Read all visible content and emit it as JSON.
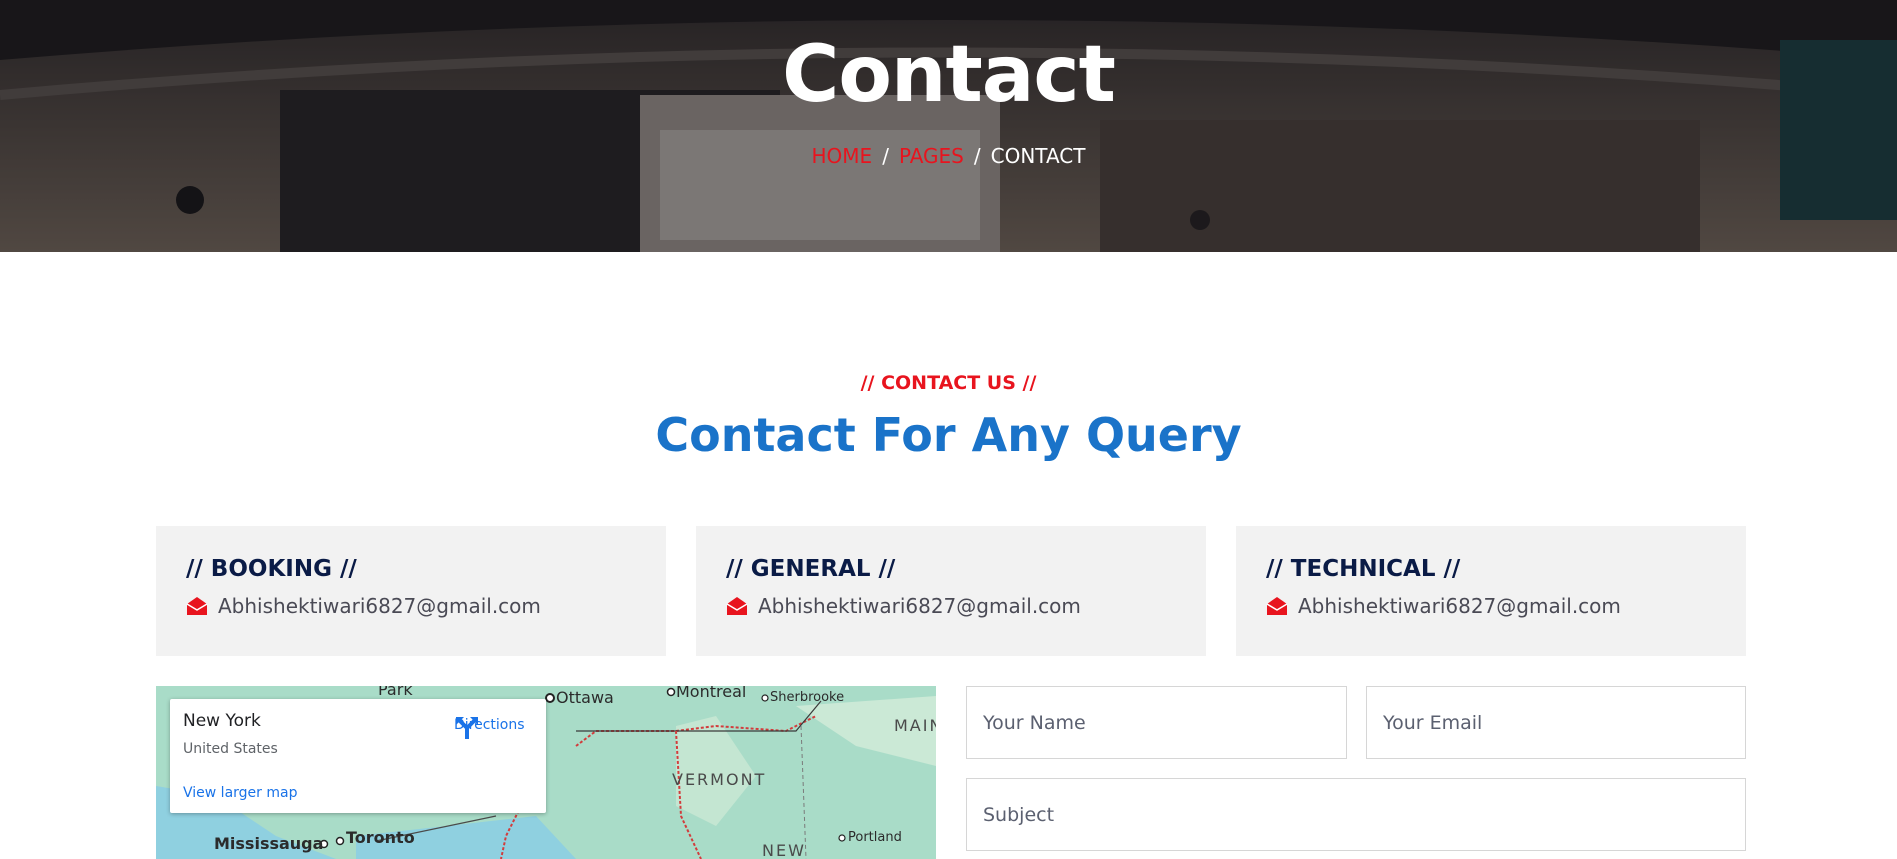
{
  "hero": {
    "title": "Contact",
    "breadcrumb": {
      "home": "HOME",
      "pages": "PAGES",
      "current": "CONTACT",
      "separator": "/"
    }
  },
  "section": {
    "eyebrow": "// CONTACT US //",
    "title": "Contact For Any Query"
  },
  "cards": [
    {
      "heading": "// BOOKING //",
      "email": "Abhishektiwari6827@gmail.com",
      "icon": "envelope-open-icon"
    },
    {
      "heading": "// GENERAL //",
      "email": "Abhishektiwari6827@gmail.com",
      "icon": "envelope-open-icon"
    },
    {
      "heading": "// TECHNICAL //",
      "email": "Abhishektiwari6827@gmail.com",
      "icon": "envelope-open-icon"
    }
  ],
  "map": {
    "place": "New York",
    "country": "United States",
    "directions": "Directions",
    "larger_map": "View larger map",
    "labels": {
      "park": "Park",
      "ottawa": "Ottawa",
      "montreal": "Montreal",
      "sherbrooke": "Sherbrooke",
      "maine": "MAIN",
      "vermont": "VERMONT",
      "mississauga": "Mississauga",
      "toronto": "Toronto",
      "portland": "Portland",
      "new": "NEW"
    }
  },
  "form": {
    "name_placeholder": "Your Name",
    "email_placeholder": "Your Email",
    "subject_placeholder": "Subject"
  },
  "colors": {
    "accent_red": "#e8141e",
    "title_blue": "#1a73c9",
    "navy": "#0a1b46",
    "card_bg": "#f2f2f2"
  }
}
